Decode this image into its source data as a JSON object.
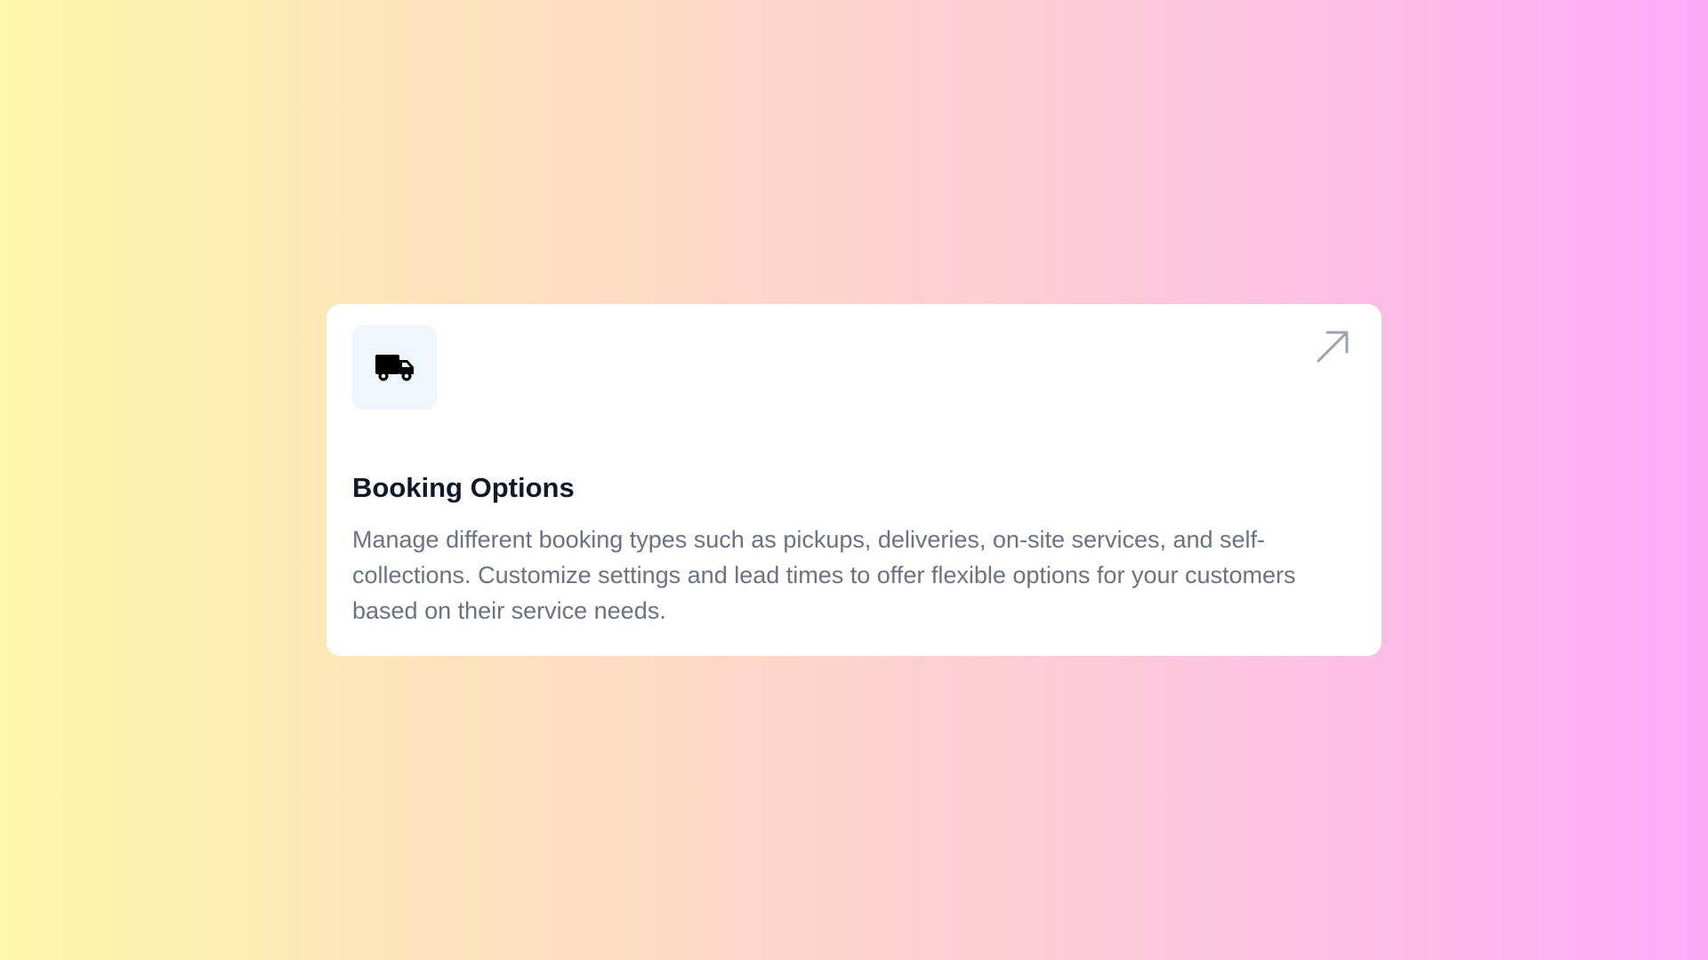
{
  "card": {
    "icon": "truck-icon",
    "link_icon": "arrow-up-right-icon",
    "title": "Booking Options",
    "description": "Manage different booking types such as pickups, deliveries, on-site services, and self-collections. Customize settings and lead times to offer flexible options for your customers based on their service needs."
  },
  "colors": {
    "icon_background": "#eff6ff",
    "title": "#111827",
    "description": "#6b7280",
    "arrow": "#9ca3af",
    "gradient_start": "#fef6a8",
    "gradient_end": "#fdaaf9"
  }
}
